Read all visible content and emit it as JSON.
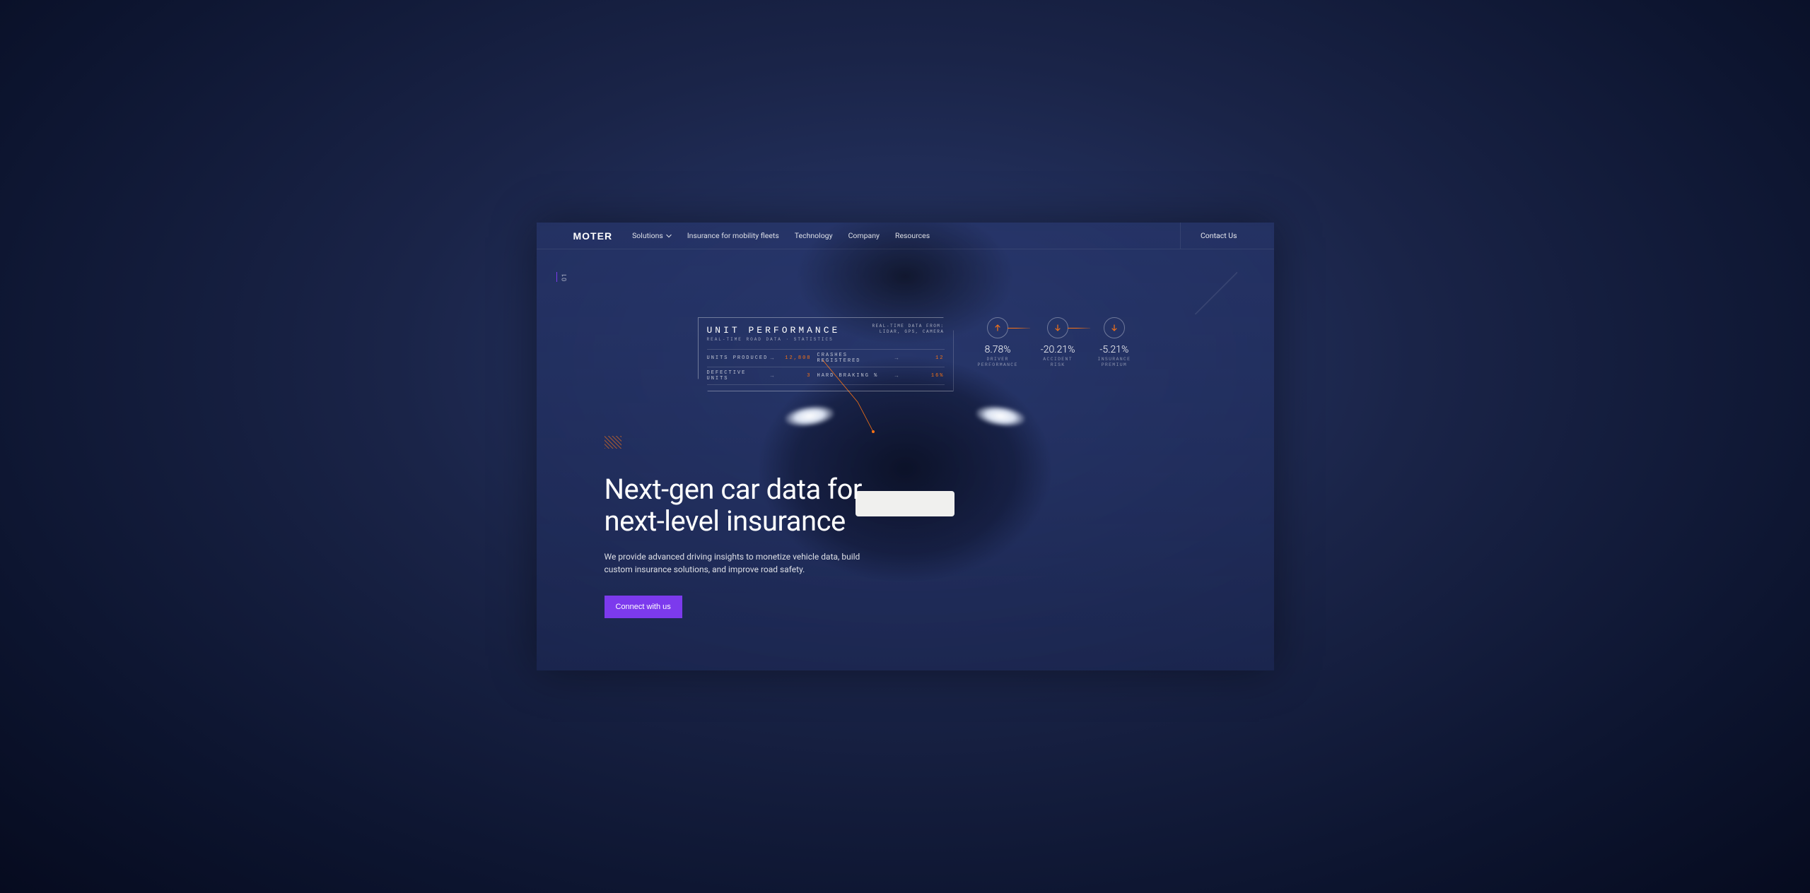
{
  "brand": "MOTER",
  "nav": {
    "items": [
      {
        "label": "Solutions",
        "has_dropdown": true
      },
      {
        "label": "Insurance for mobility fleets",
        "has_dropdown": false
      },
      {
        "label": "Technology",
        "has_dropdown": false
      },
      {
        "label": "Company",
        "has_dropdown": false
      },
      {
        "label": "Resources",
        "has_dropdown": false
      }
    ],
    "contact": "Contact Us"
  },
  "side_marker": "01",
  "hud": {
    "title": "UNIT PERFORMANCE",
    "subtitle": "REAL-TIME ROAD DATA · STATISTICS",
    "source_line1": "REAL-TIME DATA FROM:",
    "source_line2": "LIDAR, GPS, CAMERA",
    "rows": [
      {
        "label_l": "UNITS PRODUCED",
        "value_l": "12,808",
        "label_r": "CRASHES REGISTERED",
        "value_r": "12"
      },
      {
        "label_l": "DEFECTIVE UNITS",
        "value_l": "3",
        "label_r": "HARD BRAKING %",
        "value_r": "16%"
      }
    ]
  },
  "metrics": [
    {
      "direction": "up",
      "value": "8.78%",
      "label": "DRIVER\nPERFORMANCE"
    },
    {
      "direction": "down",
      "value": "-20.21%",
      "label": "ACCIDENT\nRISK"
    },
    {
      "direction": "down",
      "value": "-5.21%",
      "label": "INSURANCE\nPREMIUM"
    }
  ],
  "hero": {
    "title": "Next-gen car data for\nnext-level insurance",
    "subtitle": "We provide advanced driving insights to monetize vehicle data, build custom insurance solutions, and improve road safety.",
    "cta": "Connect with us"
  },
  "colors": {
    "accent_orange": "#f97316",
    "accent_purple": "#7c3aed"
  }
}
